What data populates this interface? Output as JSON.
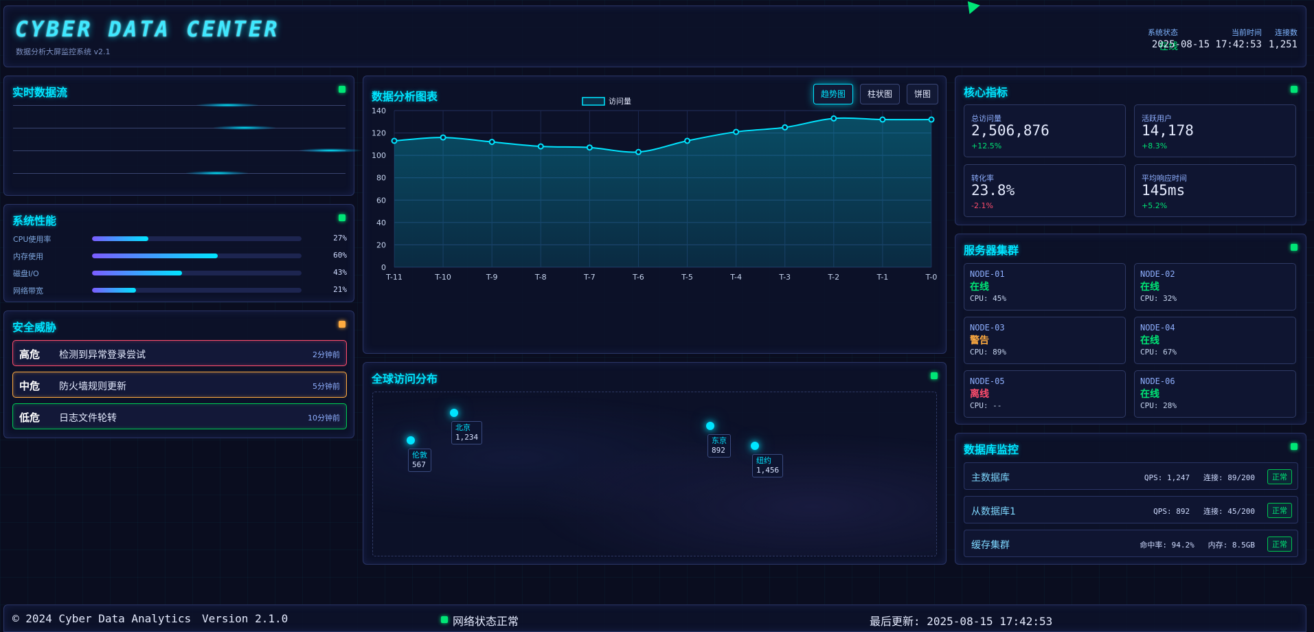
{
  "header": {
    "title": "CYBER DATA CENTER",
    "subtitle": "数据分析大屏监控系统 v2.1",
    "status_label": "系统状态",
    "status_value": "在线",
    "time_label": "当前时间",
    "time_value": "2025-08-15 17:42:53",
    "conn_label": "连接数",
    "conn_value": "1,251"
  },
  "stream": {
    "title": "实时数据流"
  },
  "performance": {
    "title": "系统性能",
    "items": [
      {
        "label": "CPU使用率",
        "pct": "27%",
        "value": 27
      },
      {
        "label": "内存使用",
        "pct": "60%",
        "value": 60
      },
      {
        "label": "磁盘I/O",
        "pct": "43%",
        "value": 43
      },
      {
        "label": "网络带宽",
        "pct": "21%",
        "value": 21
      }
    ]
  },
  "security": {
    "title": "安全威胁",
    "items": [
      {
        "level": "高危",
        "message": "检测到异常登录尝试",
        "time": "2分钟前",
        "color": "#ff4d6d"
      },
      {
        "level": "中危",
        "message": "防火墙规则更新",
        "time": "5分钟前",
        "color": "#ffab40"
      },
      {
        "level": "低危",
        "message": "日志文件轮转",
        "time": "10分钟前",
        "color": "#00c853"
      }
    ]
  },
  "chart_panel": {
    "title": "数据分析图表",
    "tabs": [
      {
        "label": "趋势图",
        "active": true
      },
      {
        "label": "柱状图",
        "active": false
      },
      {
        "label": "饼图",
        "active": false
      }
    ]
  },
  "chart_data": {
    "type": "area",
    "x": [
      "T-11",
      "T-10",
      "T-9",
      "T-8",
      "T-7",
      "T-6",
      "T-5",
      "T-4",
      "T-3",
      "T-2",
      "T-1",
      "T-0"
    ],
    "series": [
      {
        "name": "访问量",
        "values": [
          113,
          116,
          112,
          108,
          107,
          103,
          113,
          121,
          125,
          133,
          132,
          132
        ],
        "color": "#00e5ff"
      }
    ],
    "yticks": [
      0,
      20,
      40,
      60,
      80,
      100,
      120,
      140
    ],
    "ylim": [
      0,
      140
    ],
    "grid": true,
    "legend": "top-center"
  },
  "map": {
    "title": "全球访问分布",
    "cities": [
      {
        "name": "伦敦",
        "count": "567"
      },
      {
        "name": "北京",
        "count": "1,234"
      },
      {
        "name": "东京",
        "count": "892"
      },
      {
        "name": "纽约",
        "count": "1,456"
      }
    ]
  },
  "kpi": {
    "title": "核心指标",
    "cards": [
      {
        "label": "总访问量",
        "value": "2,506,876",
        "change": "+12.5%",
        "dir": "up"
      },
      {
        "label": "活跃用户",
        "value": "14,178",
        "change": "+8.3%",
        "dir": "up"
      },
      {
        "label": "转化率",
        "value": "23.8%",
        "change": "-2.1%",
        "dir": "down"
      },
      {
        "label": "平均响应时间",
        "value": "145ms",
        "change": "+5.2%",
        "dir": "up"
      }
    ]
  },
  "servers": {
    "title": "服务器集群",
    "nodes": [
      {
        "name": "NODE-01",
        "status": "在线",
        "cpu": "CPU: 45%",
        "state": "on"
      },
      {
        "name": "NODE-02",
        "status": "在线",
        "cpu": "CPU: 32%",
        "state": "on"
      },
      {
        "name": "NODE-03",
        "status": "警告",
        "cpu": "CPU: 89%",
        "state": "warn"
      },
      {
        "name": "NODE-04",
        "status": "在线",
        "cpu": "CPU: 67%",
        "state": "on"
      },
      {
        "name": "NODE-05",
        "status": "离线",
        "cpu": "CPU: --",
        "state": "off"
      },
      {
        "name": "NODE-06",
        "status": "在线",
        "cpu": "CPU: 28%",
        "state": "on"
      }
    ]
  },
  "database": {
    "title": "数据库监控",
    "rows": [
      {
        "name": "主数据库",
        "metrics": "QPS: 1,247   连接: 89/200",
        "badge": "正常"
      },
      {
        "name": "从数据库1",
        "metrics": "QPS: 892   连接: 45/200",
        "badge": "正常"
      },
      {
        "name": "缓存集群",
        "metrics": "命中率: 94.2%   内存: 8.5GB",
        "badge": "正常"
      }
    ]
  },
  "footer": {
    "copyright": "© 2024 Cyber Data Analytics",
    "version": "Version 2.1.0",
    "network": "网络状态正常",
    "updated": "最后更新: 2025-08-15 17:42:53"
  }
}
